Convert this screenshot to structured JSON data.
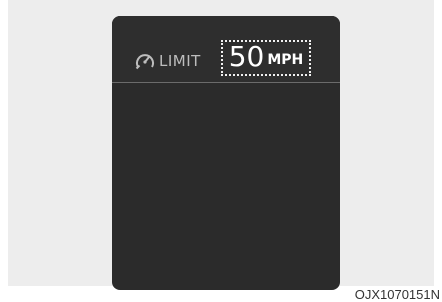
{
  "cluster": {
    "limit_label": "LIMIT",
    "speed_value": "50",
    "speed_unit": "MPH",
    "icon": "speed-limit-gauge-icon"
  },
  "figure": {
    "code": "OJX1070151N"
  },
  "colors": {
    "panel": "#2b2b2b",
    "text_primary": "#ffffff",
    "text_secondary": "#bdbdbd",
    "backdrop": "#ededed"
  }
}
